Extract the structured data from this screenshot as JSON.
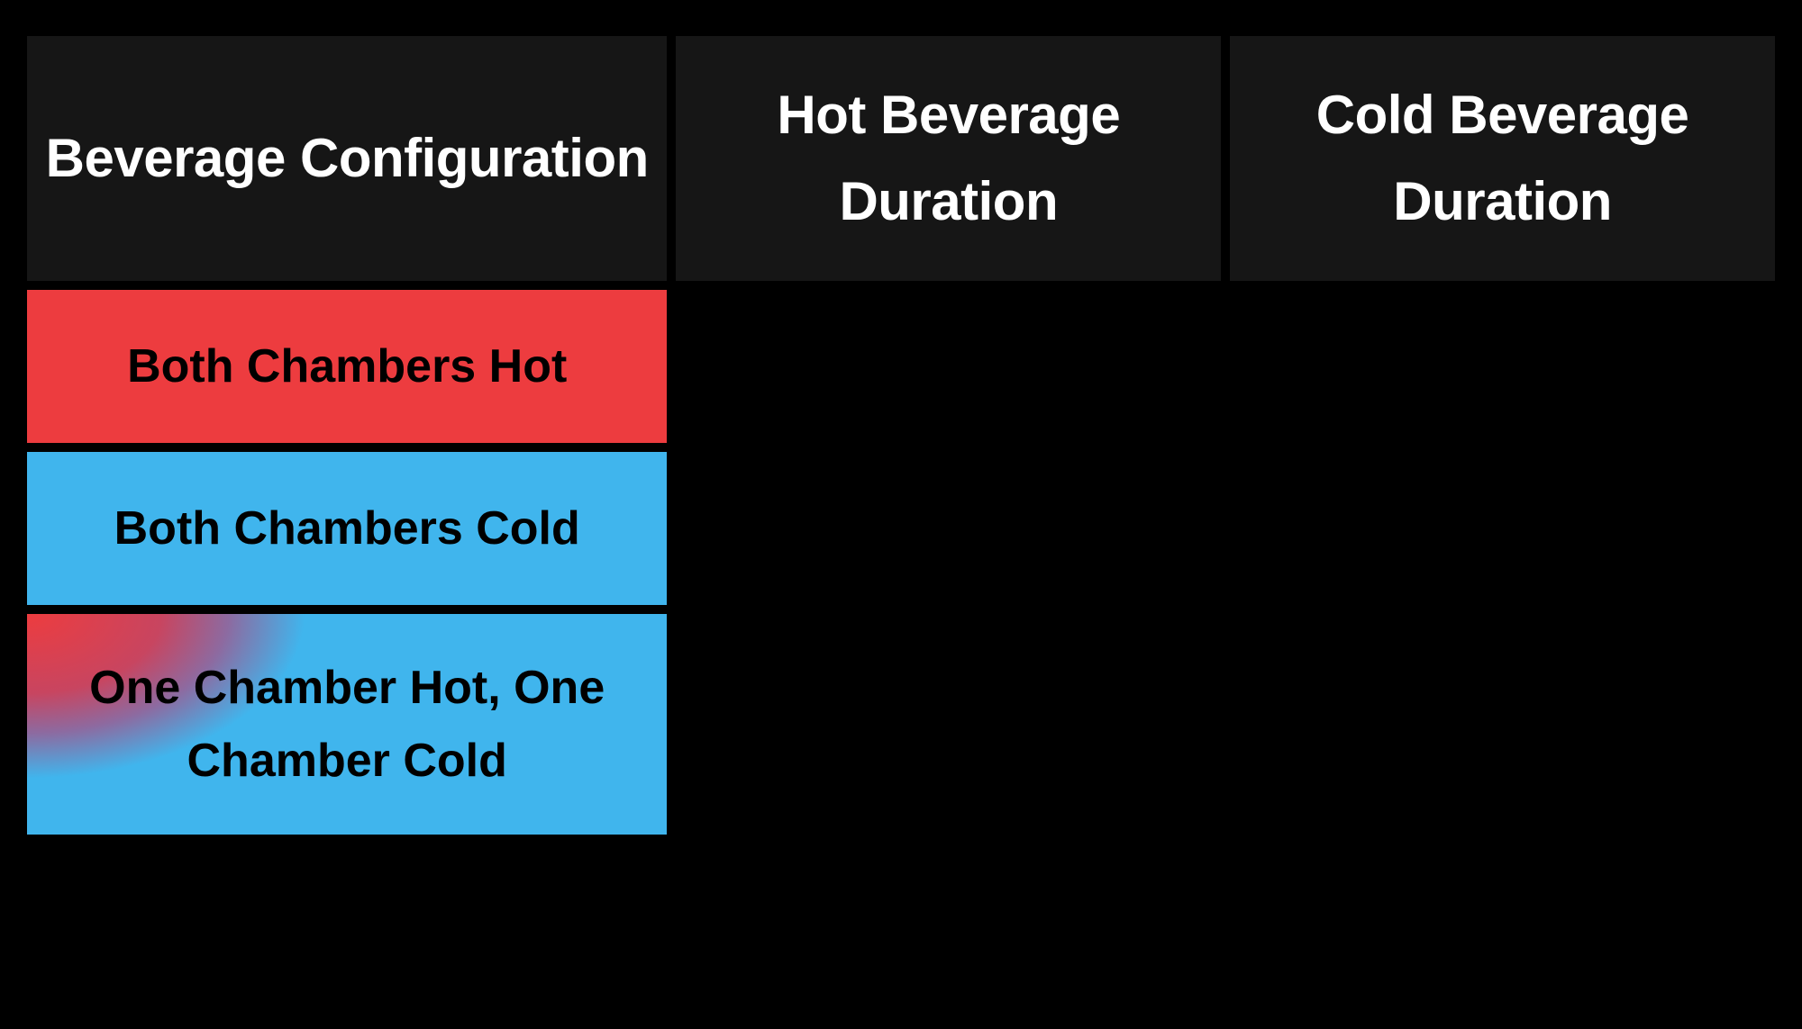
{
  "table": {
    "headers": {
      "config": "Beverage Configuration",
      "hot_duration": "Hot Beverage Duration",
      "cold_duration": "Cold Beverage Duration"
    },
    "rows": [
      {
        "config": "Both Chambers Hot",
        "hot_duration": "",
        "cold_duration": ""
      },
      {
        "config": "Both Chambers Cold",
        "hot_duration": "",
        "cold_duration": ""
      },
      {
        "config": "One Chamber Hot, One Chamber Cold",
        "hot_duration": "",
        "cold_duration": ""
      }
    ]
  }
}
